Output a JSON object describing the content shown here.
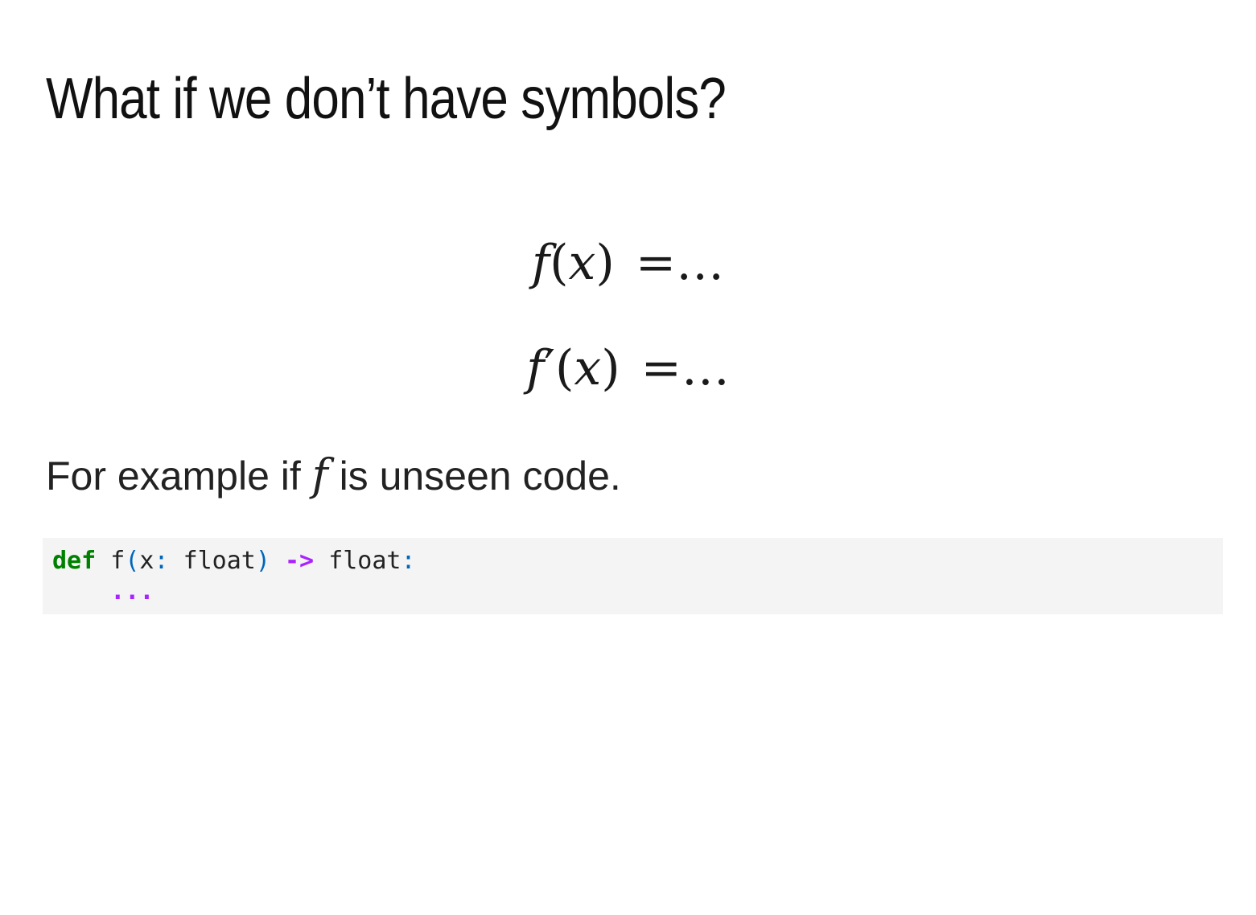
{
  "slide": {
    "title": "What if we don’t have symbols?",
    "equations": [
      {
        "func": "f",
        "prime": "",
        "open_paren": "(",
        "var": "x",
        "close_paren": ")",
        "equals": "=",
        "rhs": "…"
      },
      {
        "func": "f",
        "prime": "′",
        "open_paren": "(",
        "var": "x",
        "close_paren": ")",
        "equals": "=",
        "rhs": "…"
      }
    ],
    "paragraph": {
      "before": "For example if ",
      "math": "f",
      "after": " is unseen code."
    },
    "code": {
      "line1": {
        "keyword": "def",
        "func_name": "f",
        "open_paren": "(",
        "param": "x",
        "colon1": ":",
        "param_type": "float",
        "close_paren": ")",
        "arrow": "->",
        "return_type": "float",
        "colon2": ":"
      },
      "line2": {
        "indent": "    ",
        "ellipsis": "..."
      }
    }
  },
  "colors": {
    "code_background": "#f4f4f4",
    "keyword": "#008000",
    "punctuation": "#0066bb",
    "operator": "#aa22ff",
    "text": "#222222"
  }
}
